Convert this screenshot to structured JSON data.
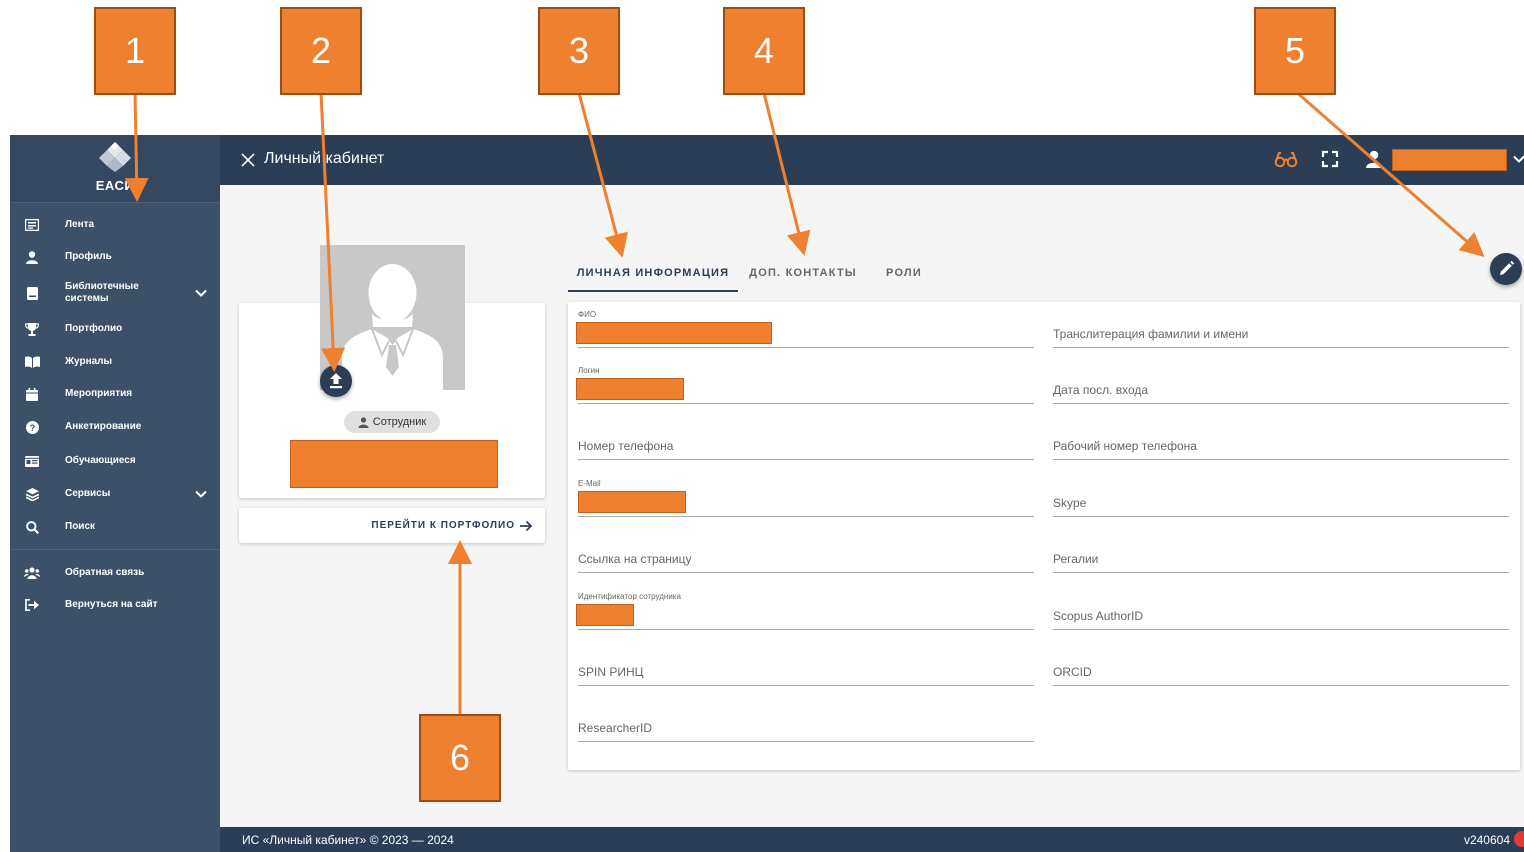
{
  "app": {
    "logo_text": "ЕАСИ",
    "header_title": "Личный кабинет",
    "footer_copy": "ИС «Личный кабинет» © 2023 — 2024",
    "footer_version": "v240604"
  },
  "sidebar": {
    "items": [
      {
        "label": "Лента",
        "icon": "newspaper-icon"
      },
      {
        "label": "Профиль",
        "icon": "person-icon"
      },
      {
        "label": "Библиотечные системы",
        "icon": "book-icon",
        "expandable": true
      },
      {
        "label": "Портфолио",
        "icon": "trophy-icon"
      },
      {
        "label": "Журналы",
        "icon": "open-book-icon"
      },
      {
        "label": "Мероприятия",
        "icon": "calendar-icon"
      },
      {
        "label": "Анкетирование",
        "icon": "question-circle-icon"
      },
      {
        "label": "Обучающиеся",
        "icon": "id-card-icon"
      },
      {
        "label": "Сервисы",
        "icon": "layers-icon",
        "expandable": true
      },
      {
        "label": "Поиск",
        "icon": "search-icon"
      },
      {
        "label": "Обратная связь",
        "icon": "users-icon"
      },
      {
        "label": "Вернуться на сайт",
        "icon": "sign-out-icon"
      }
    ]
  },
  "profile": {
    "role_chip": "Сотрудник",
    "portfolio_button": "ПЕРЕЙТИ К ПОРТФОЛИО"
  },
  "tabs": [
    {
      "label": "ЛИЧНАЯ ИНФОРМАЦИЯ",
      "active": true
    },
    {
      "label": "ДОП. КОНТАКТЫ",
      "active": false
    },
    {
      "label": "РОЛИ",
      "active": false
    }
  ],
  "form": {
    "left": [
      {
        "label": "ФИО",
        "filled": true
      },
      {
        "label": "Логин",
        "filled": true
      },
      {
        "label": "Номер телефона",
        "filled": false
      },
      {
        "label": "E-Mail",
        "filled": true
      },
      {
        "label": "Ссылка на страницу",
        "filled": false
      },
      {
        "label": "Идентификатор сотрудника",
        "filled": true
      },
      {
        "label": "SPIN РИНЦ",
        "filled": false
      },
      {
        "label": "ResearcherID",
        "filled": false
      }
    ],
    "right": [
      {
        "label": "Транслитерация фамилии и имени",
        "filled": false
      },
      {
        "label": "Дата посл. входа",
        "filled": false
      },
      {
        "label": "Рабочий номер телефона",
        "filled": false
      },
      {
        "label": "Skype",
        "filled": false
      },
      {
        "label": "Регалии",
        "filled": false
      },
      {
        "label": "Scopus AuthorID",
        "filled": false
      },
      {
        "label": "ORCID",
        "filled": false
      }
    ]
  },
  "annotations": [
    "1",
    "2",
    "3",
    "4",
    "5",
    "6"
  ],
  "colors": {
    "sidebar": "#3c5068",
    "header": "#2b3e55",
    "annotation": "#ee8030",
    "redaction": "#ee8030"
  }
}
